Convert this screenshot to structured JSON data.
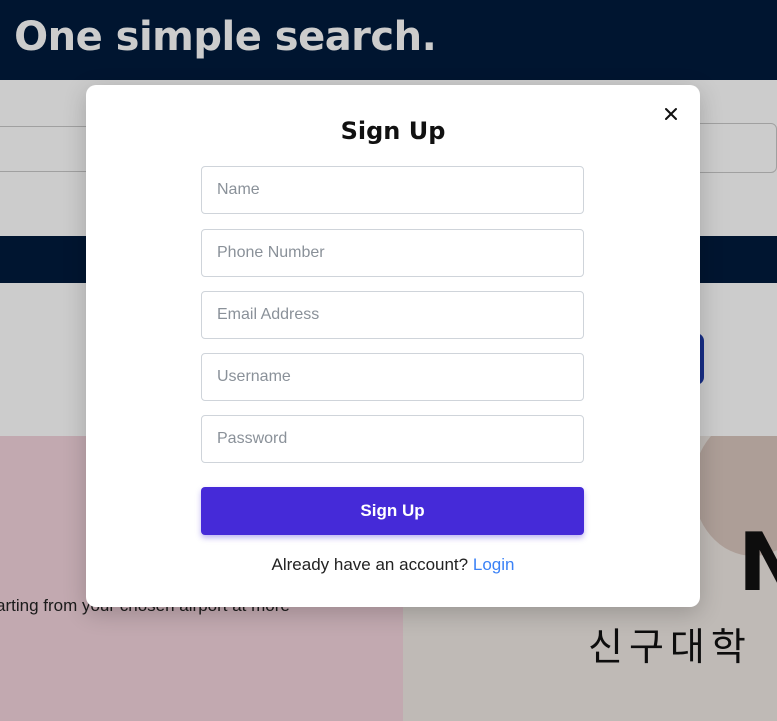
{
  "background": {
    "hero_title": ". One simple search.",
    "promo_text": "arting from your chosen airport at more",
    "promo_letter": "N",
    "promo_korean": "신구대학"
  },
  "modal": {
    "title": "Sign Up",
    "close_icon": "close-icon",
    "fields": {
      "name": {
        "placeholder": "Name"
      },
      "phone": {
        "placeholder": "Phone Number"
      },
      "email": {
        "placeholder": "Email Address"
      },
      "username": {
        "placeholder": "Username"
      },
      "password": {
        "placeholder": "Password"
      }
    },
    "submit_label": "Sign Up",
    "footer_prefix": "Already have an account?",
    "login_label": "Login"
  },
  "colors": {
    "brand_navy": "#001b3d",
    "button_purple": "#452ad8",
    "link_blue": "#3b82f6"
  }
}
